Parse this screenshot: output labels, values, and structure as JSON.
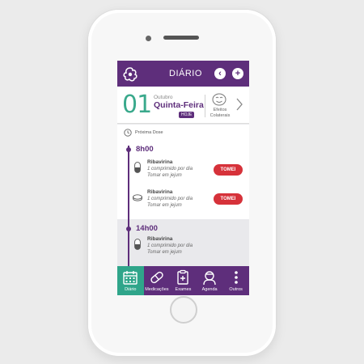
{
  "header": {
    "title": "DIÁRIO",
    "back_icon": "‹",
    "add_icon": "+"
  },
  "date": {
    "day": "01",
    "month": "Outubro",
    "weekday": "Quinta-Feira",
    "today_badge": "HOJE",
    "side_effects_label_1": "Efeitos",
    "side_effects_label_2": "Colaterais"
  },
  "next_dose_label": "Próxima Dose",
  "schedule": [
    {
      "time": "8h00",
      "meds": [
        {
          "name": "Ribavirina",
          "dose": "1 comprimido por dia",
          "note": "Tomar em jejum",
          "icon": "capsule-icon",
          "action": "TOMEI"
        },
        {
          "name": "Ribavirina",
          "dose": "1 comprimido por dia",
          "note": "Tomar em jejum",
          "icon": "tablet-icon",
          "action": "TOMEI"
        }
      ]
    },
    {
      "time": "14h00",
      "meds": [
        {
          "name": "Ribavirina",
          "dose": "1 comprimido por dia",
          "note": "Tomar em jejum",
          "icon": "capsule-icon"
        }
      ]
    }
  ],
  "tabs": [
    {
      "label": "Diário",
      "icon": "calendar-icon",
      "active": true
    },
    {
      "label": "Medicações",
      "icon": "pill-icon",
      "active": false
    },
    {
      "label": "Exames",
      "icon": "clipboard-icon",
      "active": false
    },
    {
      "label": "Agenda",
      "icon": "doctor-icon",
      "active": false
    },
    {
      "label": "Outros",
      "icon": "more-icon",
      "active": false
    }
  ],
  "colors": {
    "brand_purple": "#5e2e7b",
    "accent_teal": "#2fa58a",
    "day_green": "#3aa98c",
    "action_red": "#d6323a"
  }
}
